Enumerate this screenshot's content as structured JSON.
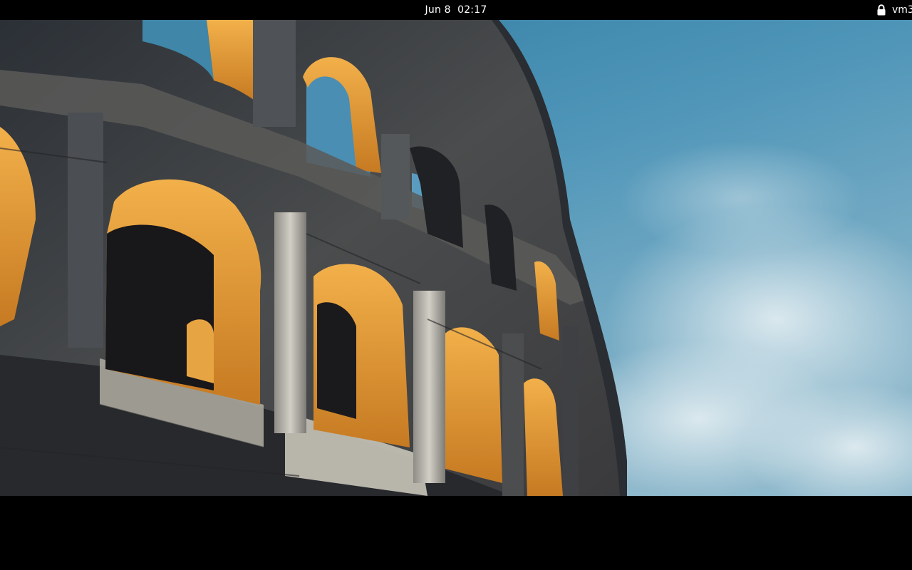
{
  "top_bar": {
    "date": "Jun 8",
    "time": "02:17",
    "user": "vm3"
  },
  "icons": {
    "lock": "lock-icon"
  },
  "wallpaper": {
    "subject": "Colosseum",
    "colors": {
      "sky_top": "#3f86a8",
      "sky_bottom": "#b8d3df",
      "stone": "#3e4247",
      "stone_light": "#b5b2a8",
      "arch_glow": "#e9a33a",
      "shadow": "#17161a"
    }
  }
}
